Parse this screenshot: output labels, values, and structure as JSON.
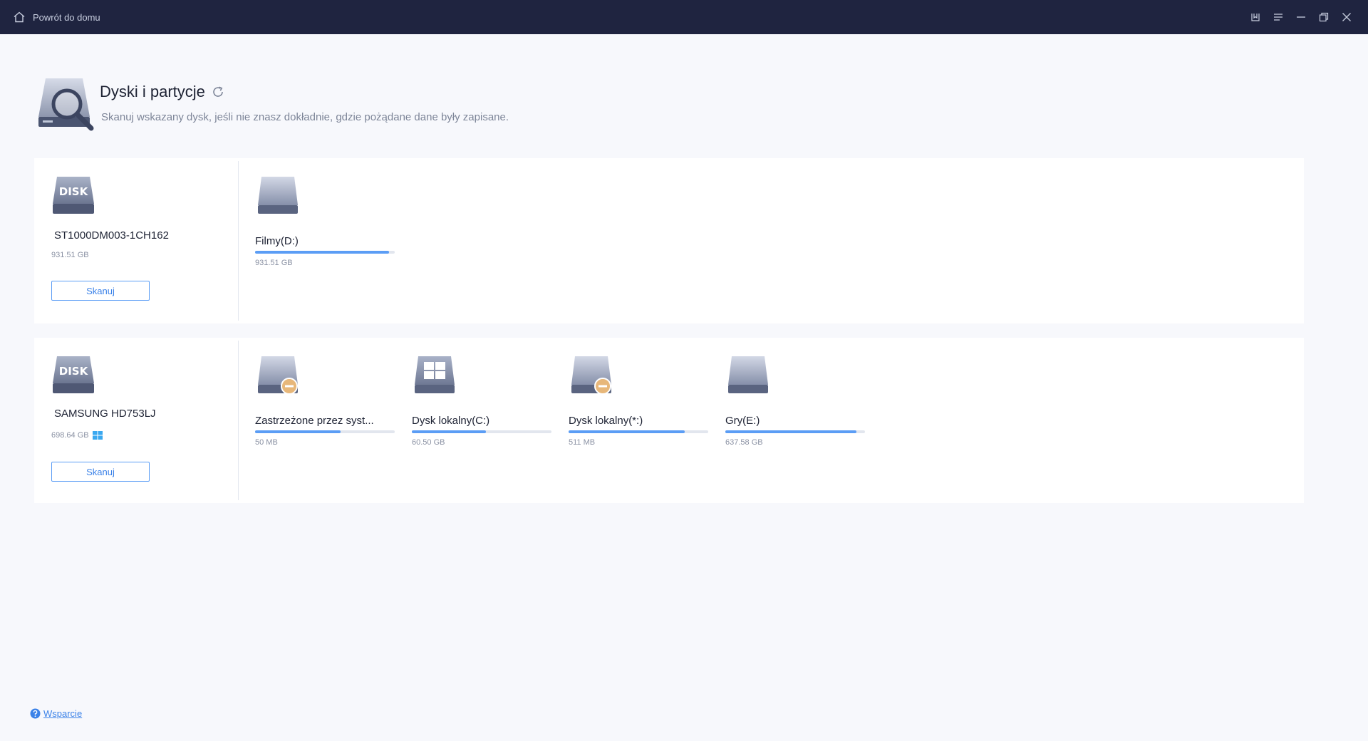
{
  "titlebar": {
    "home_label": "Powrót do domu",
    "controls": [
      "bookmark-icon",
      "menu-icon",
      "minimize-icon",
      "restore-icon",
      "close-icon"
    ]
  },
  "header": {
    "title": "Dyski i partycje",
    "subtitle": "Skanuj wskazany dysk, jeśli nie znasz dokładnie, gdzie pożądane dane były zapisane."
  },
  "disks": [
    {
      "name": "ST1000DM003-1CH162",
      "size": "931.51 GB",
      "icon_label": "DISK",
      "system_disk": false,
      "scan_label": "Skanuj",
      "partitions": [
        {
          "name": "Filmy(D:)",
          "size": "931.51 GB",
          "usage": 0.96,
          "icon": "drive-icon"
        }
      ]
    },
    {
      "name": "SAMSUNG HD753LJ",
      "size": "698.64 GB",
      "icon_label": "DISK",
      "system_disk": true,
      "scan_label": "Skanuj",
      "partitions": [
        {
          "name": "Zastrzeżone przez syst...",
          "size": "50 MB",
          "usage": 0.61,
          "icon": "reserved-drive-icon"
        },
        {
          "name": "Dysk lokalny(C:)",
          "size": "60.50 GB",
          "usage": 0.53,
          "icon": "windows-drive-icon"
        },
        {
          "name": "Dysk lokalny(*:)",
          "size": "511 MB",
          "usage": 0.83,
          "icon": "reserved-drive-icon"
        },
        {
          "name": "Gry(E:)",
          "size": "637.58 GB",
          "usage": 0.94,
          "icon": "drive-icon"
        }
      ]
    }
  ],
  "footer": {
    "support_label": "Wsparcie"
  },
  "colors": {
    "titlebar": "#1f2440",
    "accent": "#5b9df5",
    "background": "#f7f8fc"
  }
}
